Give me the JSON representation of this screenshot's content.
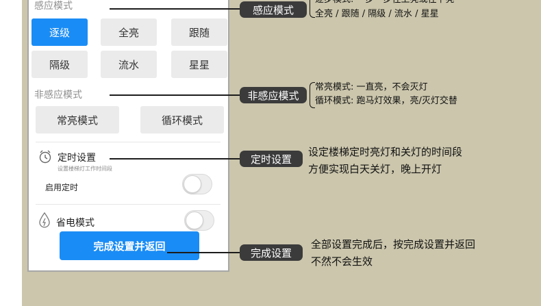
{
  "phone": {
    "sensor_section_title": "感应模式",
    "sensor_modes": [
      "逐级",
      "全亮",
      "跟随",
      "隔级",
      "流水",
      "星星"
    ],
    "active_mode": "逐级",
    "nonsensor_section_title": "非感应模式",
    "nonsensor_modes": [
      "常亮模式",
      "循环模式"
    ],
    "timer": {
      "title": "定时设置",
      "subtitle": "设置楼梯灯工作时间段",
      "enable_label": "启用定时",
      "enabled": false
    },
    "power_save": {
      "label": "省电模式",
      "enabled": false
    },
    "submit_label": "完成设置并返回"
  },
  "annotations": {
    "sensor": {
      "pill": "感应模式",
      "line1": "逐步模式: 一步一步往上亮或往下亮",
      "line2": "全亮 / 跟随 / 隔级 / 流水 / 星星"
    },
    "nonsensor": {
      "pill": "非感应模式",
      "line1": "常亮模式: 一直亮，不会灭灯",
      "line2": "循环模式: 跑马灯效果，亮/灭灯交替"
    },
    "timer": {
      "pill": "定时设置",
      "line1": "设定楼梯定时亮灯和关灯的时间段",
      "line2": "方便实现白天关灯，晚上开灯"
    },
    "finish": {
      "pill": "完成设置",
      "line1": "全部设置完成后，按完成设置并返回",
      "line2": "不然不会生效"
    }
  },
  "colors": {
    "background": "#cbc6ac",
    "accent_blue": "#1a8cf5",
    "pill_dark": "#3b3b3b"
  }
}
